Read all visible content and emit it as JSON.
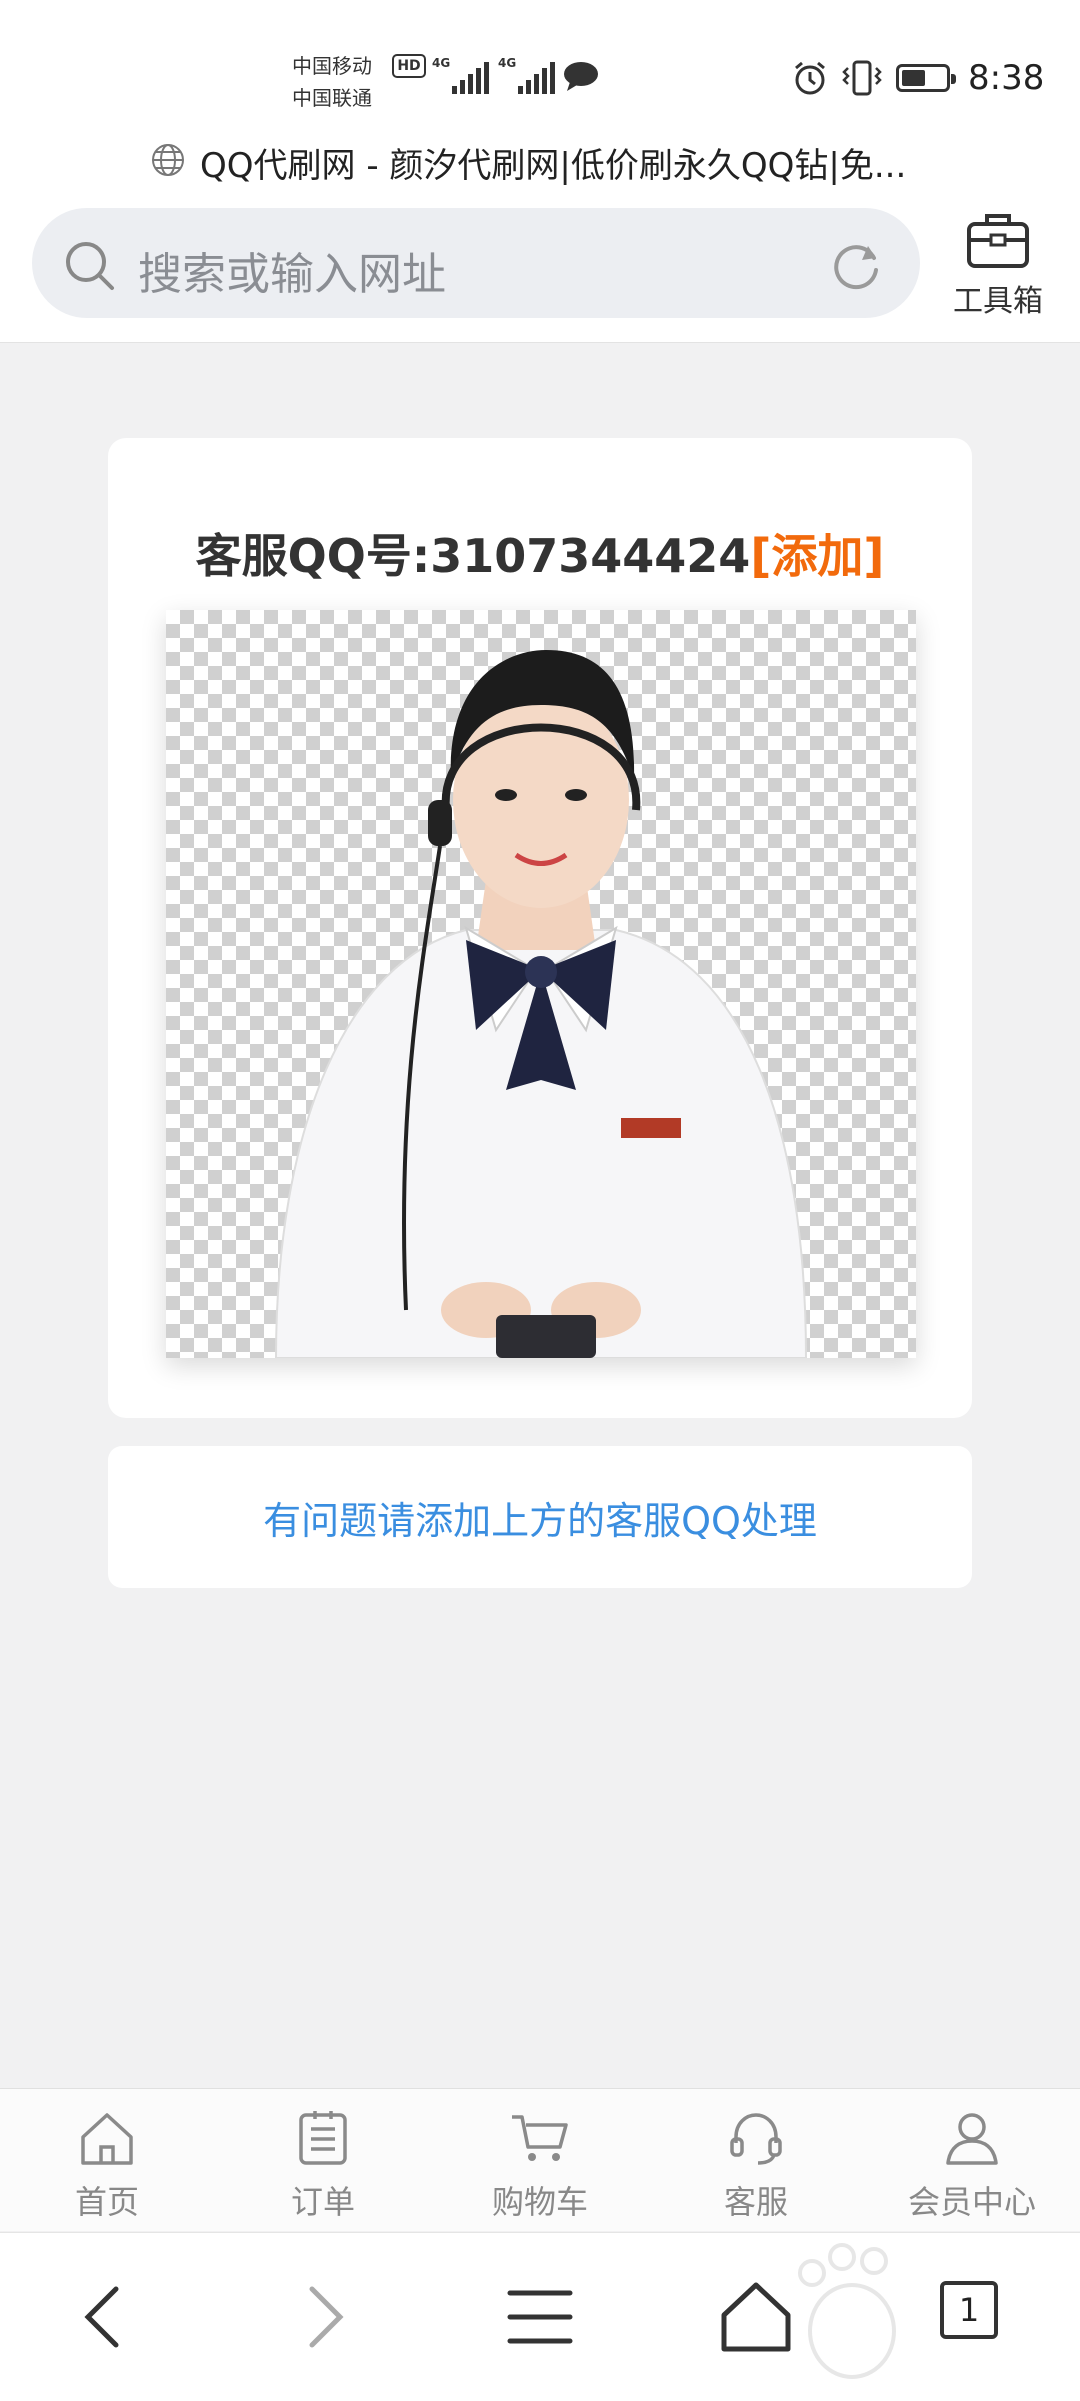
{
  "status_bar": {
    "carrier_1": "中国移动",
    "carrier_2": "中国联通",
    "hd_badge": "HD",
    "network_1": "4G",
    "network_2": "4G",
    "battery_level": 0.55,
    "time": "8:38"
  },
  "browser": {
    "page_title": "QQ代刷网 - 颜汐代刷网|低价刷永久QQ钻|免...",
    "search_placeholder": "搜索或输入网址",
    "toolbox_label": "工具箱",
    "tab_count": "1"
  },
  "card": {
    "heading_prefix": "客服QQ号:3107344424",
    "heading_link": "[添加]"
  },
  "notice": {
    "text": "有问题请添加上方的客服QQ处理"
  },
  "bottom_nav": {
    "items": [
      {
        "label": "首页",
        "icon": "home-icon"
      },
      {
        "label": "订单",
        "icon": "order-list-icon"
      },
      {
        "label": "购物车",
        "icon": "cart-icon"
      },
      {
        "label": "客服",
        "icon": "headset-icon"
      },
      {
        "label": "会员中心",
        "icon": "user-icon"
      }
    ]
  },
  "colors": {
    "accent_link": "#f26a0c",
    "notice_text": "#3a8ee0",
    "page_bg": "#f1f1f2"
  }
}
